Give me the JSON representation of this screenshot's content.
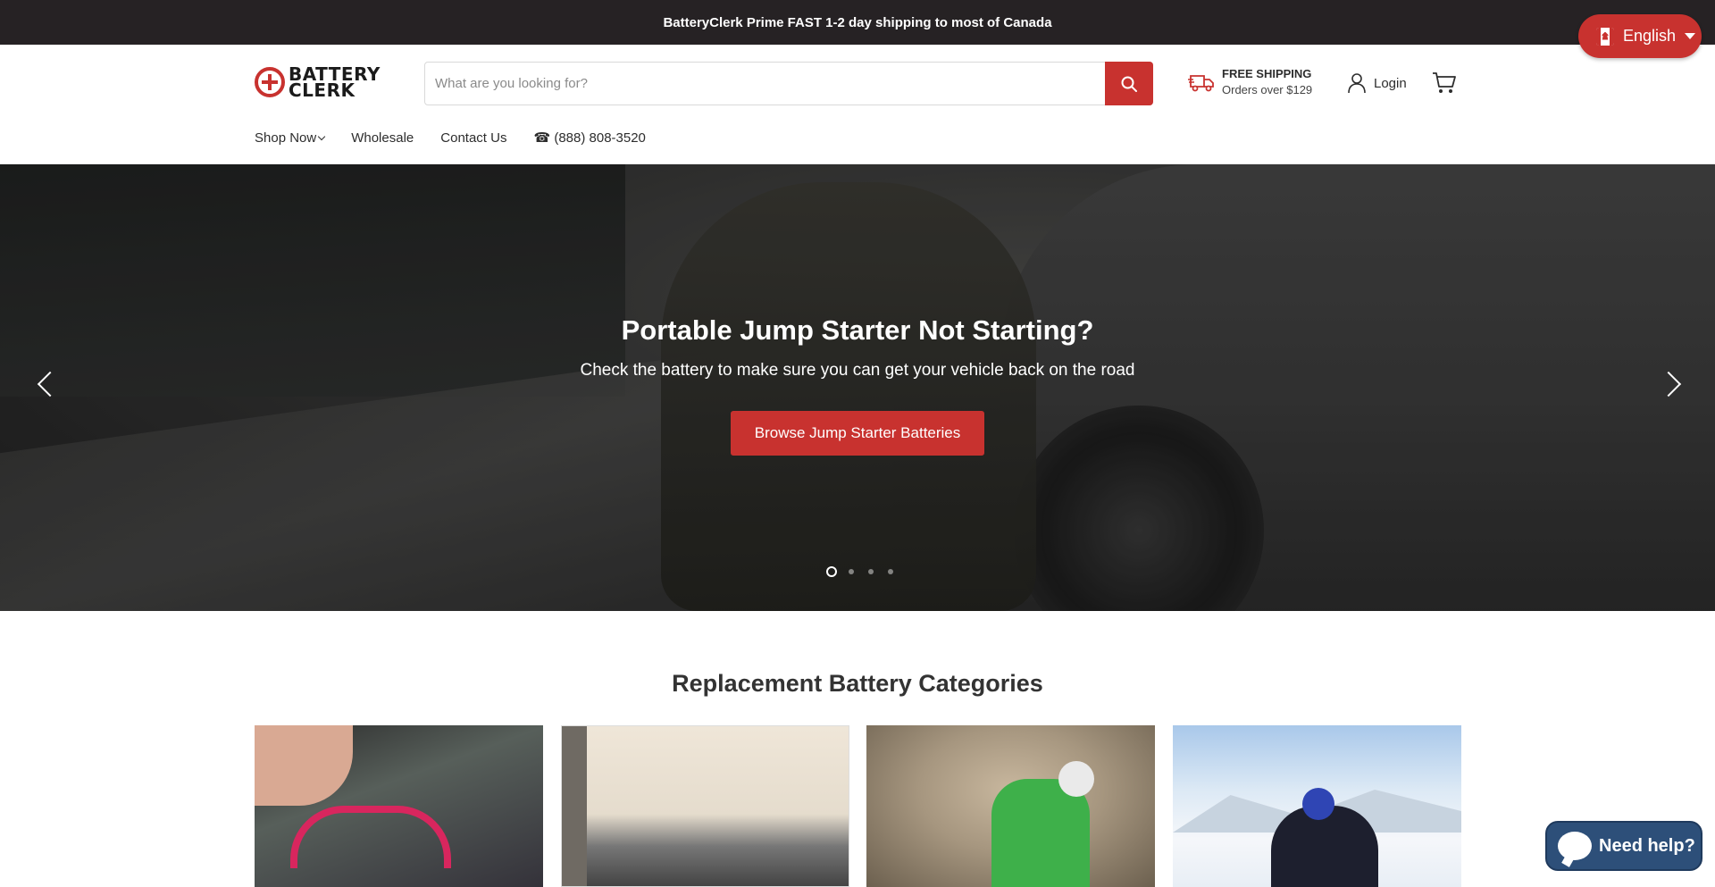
{
  "announcement": {
    "text": "BatteryClerk Prime FAST 1-2 day shipping to most of Canada"
  },
  "language": {
    "label": "English"
  },
  "header": {
    "logo_text_line1": "BATTERY",
    "logo_text_line2": "CLERK",
    "search": {
      "placeholder": "What are you looking for?",
      "value": ""
    },
    "shipping": {
      "title": "FREE SHIPPING",
      "subtitle": "Orders over $129"
    },
    "login_label": "Login"
  },
  "nav": {
    "items": [
      {
        "label": "Shop Now"
      },
      {
        "label": "Wholesale"
      },
      {
        "label": "Contact Us"
      },
      {
        "label": "☎ (888) 808-3520"
      }
    ]
  },
  "hero": {
    "title": "Portable Jump Starter Not Starting?",
    "subtitle": "Check the battery to make sure you can get your vehicle back on the road",
    "cta_label": "Browse Jump Starter Batteries",
    "slide_count": 4,
    "active_slide": 1
  },
  "categories": {
    "title": "Replacement Battery Categories"
  },
  "help": {
    "label": "Need help?"
  },
  "colors": {
    "accent": "#c8322f",
    "topbar": "#262224",
    "help": "#2d4f79"
  },
  "icons": [
    "search-icon",
    "delivery-truck-icon",
    "user-icon",
    "cart-icon",
    "chevron-left-icon",
    "chevron-right-icon",
    "chat-bubble-icon",
    "canada-flag-icon"
  ]
}
